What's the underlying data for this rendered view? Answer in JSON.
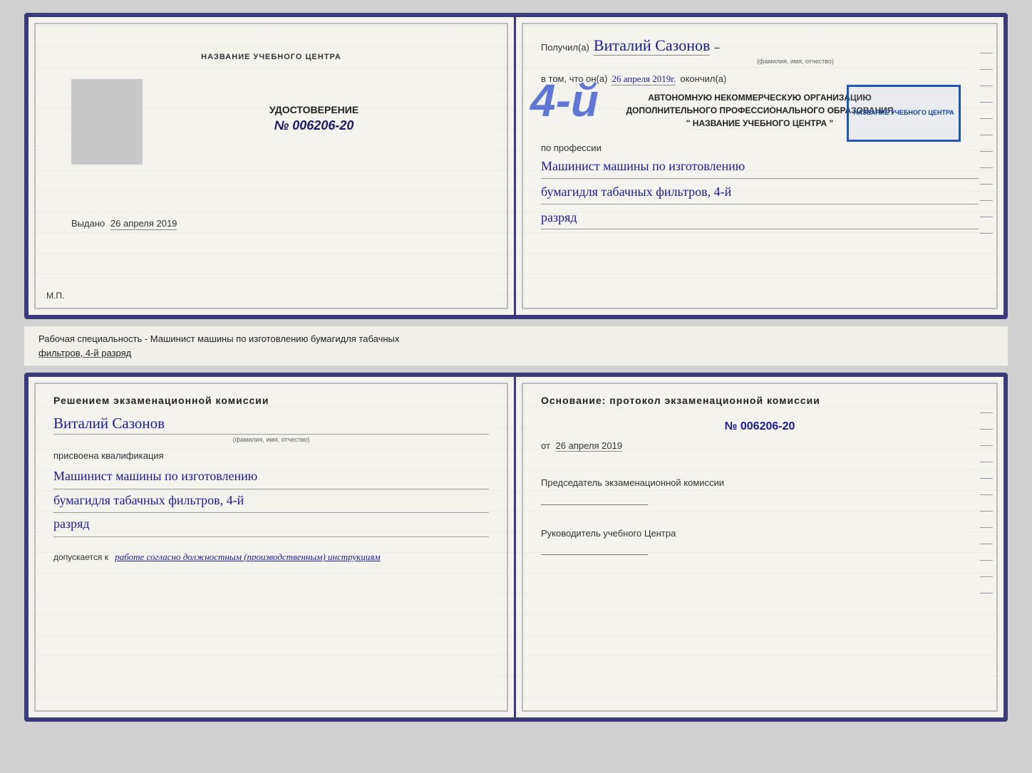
{
  "page": {
    "background_color": "#d0d0d0"
  },
  "top_cert": {
    "left": {
      "title": "НАЗВАНИЕ УЧЕБНОГО ЦЕНТРА",
      "udostoverenie_label": "УДОСТОВЕРЕНИЕ",
      "cert_number": "№ 006206-20",
      "vydano_label": "Выдано",
      "vydano_date": "26 апреля 2019",
      "mp_label": "М.П."
    },
    "right": {
      "poluchil_prefix": "Получил(а)",
      "recipient_name": "Виталий Сазонов",
      "fio_hint": "(фамилия, имя, отчество)",
      "vtom_prefix": "в том, что он(а)",
      "date_handwritten": "26 апреля 2019г.",
      "okonchil_suffix": "окончил(а)",
      "big_number": "4-й",
      "org_line1": "АВТОНОМНУЮ НЕКОММЕРЧЕСКУЮ ОРГАНИЗАЦИЮ",
      "org_line2": "ДОПОЛНИТЕЛЬНОГО ПРОФЕССИОНАЛЬНОГО ОБРАЗОВАНИЯ",
      "org_line3": "\" НАЗВАНИЕ УЧЕБНОГО ЦЕНТРА \"",
      "po_professii_label": "по профессии",
      "profession_line1": "Машинист машины по изготовлению",
      "profession_line2": "бумагидля табачных фильтров, 4-й",
      "profession_line3": "разряд",
      "stamp_line1": "НАЗВАНИЕ УЧЕБНОГО ЦЕНТРА"
    }
  },
  "middle_band": {
    "text_prefix": "Рабочая специальность - Машинист машины по изготовлению бумагидля табачных",
    "text_underlined": "фильтров, 4-й разряд"
  },
  "bottom_cert": {
    "left": {
      "resheniem_label": "Решением  экзаменационной  комиссии",
      "name_handwritten": "Виталий Сазонов",
      "fio_hint": "(фамилия, имя, отчество)",
      "prisvoena_label": "присвоена квалификация",
      "qualification_line1": "Машинист машины по изготовлению",
      "qualification_line2": "бумагидля табачных фильтров, 4-й",
      "qualification_line3": "разряд",
      "dopuskaetsya_prefix": "допускается к",
      "dopuskaetsya_value": "работе согласно должностным (производственным) инструкциям"
    },
    "right": {
      "osnovanie_label": "Основание: протокол экзаменационной  комиссии",
      "protocol_number": "№  006206-20",
      "ot_prefix": "от",
      "ot_date": "26 апреля 2019",
      "predsedatel_label": "Председатель экзаменационной комиссии",
      "rukovoditel_label": "Руководитель учебного Центра"
    }
  }
}
